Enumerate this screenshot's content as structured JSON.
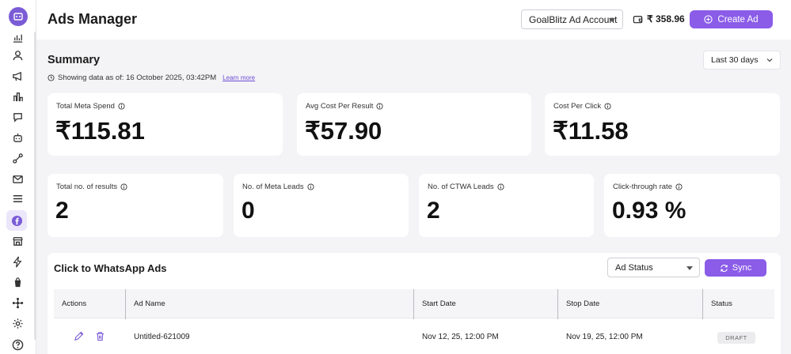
{
  "colors": {
    "accent": "#8a5ce8",
    "background": "#f4f4f6"
  },
  "header": {
    "title": "Ads Manager",
    "account": "GoalBlitz Ad Account",
    "wallet_balance": "₹ 358.96",
    "create_label": "Create Ad"
  },
  "summary": {
    "title": "Summary",
    "note": "Showing data as of: 16 October 2025, 03:42PM",
    "learn_more": "Learn more",
    "range": "Last 30 days",
    "metrics_top": [
      {
        "label": "Total Meta Spend",
        "value": "₹115.81"
      },
      {
        "label": "Avg Cost Per Result",
        "value": "₹57.90"
      },
      {
        "label": "Cost Per Click",
        "value": "₹11.58"
      }
    ],
    "metrics_bottom": [
      {
        "label": "Total no. of results",
        "value": "2"
      },
      {
        "label": "No. of Meta Leads",
        "value": "0"
      },
      {
        "label": "No. of CTWA Leads",
        "value": "2"
      },
      {
        "label": "Click-through rate",
        "value": "0.93 %"
      }
    ]
  },
  "ctwa": {
    "title": "Click to WhatsApp Ads",
    "status_filter": "Ad Status",
    "sync_label": "Sync",
    "columns": [
      "Actions",
      "Ad Name",
      "Start Date",
      "Stop Date",
      "Status"
    ],
    "rows": [
      {
        "ad_name": "Untitled-621009",
        "start": "Nov 12, 25, 12:00 PM",
        "stop": "Nov 19, 25, 12:00 PM",
        "status": "DRAFT"
      }
    ]
  },
  "sidebar_icons": [
    "chart-icon",
    "user-icon",
    "megaphone-icon",
    "bar-chart-icon",
    "chat-icon",
    "bot-icon",
    "flow-icon",
    "mail-icon",
    "list-icon",
    "facebook-icon",
    "store-icon",
    "lightning-icon",
    "shopify-icon",
    "integration-icon",
    "gear-icon",
    "help-icon"
  ]
}
